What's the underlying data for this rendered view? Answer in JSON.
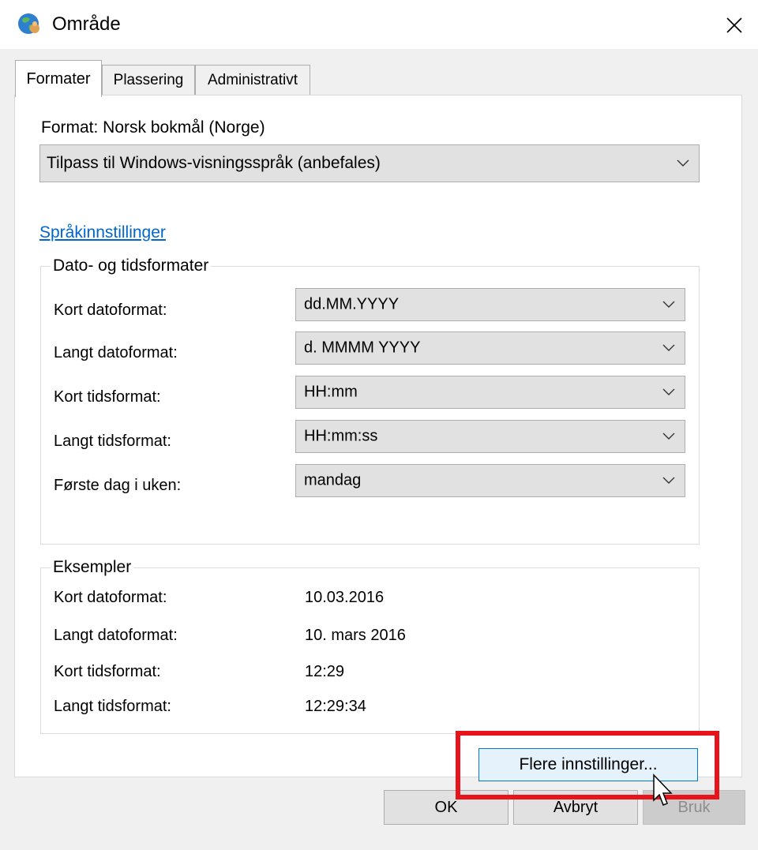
{
  "window": {
    "title": "Område",
    "icon": "globe-people-icon",
    "close_icon": "close-icon"
  },
  "tabs": [
    {
      "label": "Formater",
      "active": true
    },
    {
      "label": "Plassering",
      "active": false
    },
    {
      "label": "Administrativt",
      "active": false
    }
  ],
  "format": {
    "label": "Format: Norsk bokmål (Norge)",
    "selected": "Tilpass til Windows-visningsspråk (anbefales)"
  },
  "language_link": "Språkinnstillinger",
  "date_time_formats": {
    "title": "Dato- og tidsformater",
    "rows": [
      {
        "label": "Kort datoformat:",
        "value": "dd.MM.YYYY"
      },
      {
        "label": "Langt datoformat:",
        "value": "d. MMMM YYYY"
      },
      {
        "label": "Kort tidsformat:",
        "value": "HH:mm"
      },
      {
        "label": "Langt tidsformat:",
        "value": "HH:mm:ss"
      },
      {
        "label": "Første dag i uken:",
        "value": "mandag"
      }
    ]
  },
  "examples": {
    "title": "Eksempler",
    "rows": [
      {
        "label": "Kort datoformat:",
        "value": "10.03.2016"
      },
      {
        "label": "Langt datoformat:",
        "value": "10. mars 2016"
      },
      {
        "label": "Kort tidsformat:",
        "value": "12:29"
      },
      {
        "label": "Langt tidsformat:",
        "value": "12:29:34"
      }
    ]
  },
  "buttons": {
    "more_settings": "Flere innstillinger...",
    "ok": "OK",
    "cancel": "Avbryt",
    "apply": "Bruk"
  },
  "colors": {
    "highlight": "#e8141b",
    "link": "#0066cc",
    "focus_border": "#0078d7"
  }
}
